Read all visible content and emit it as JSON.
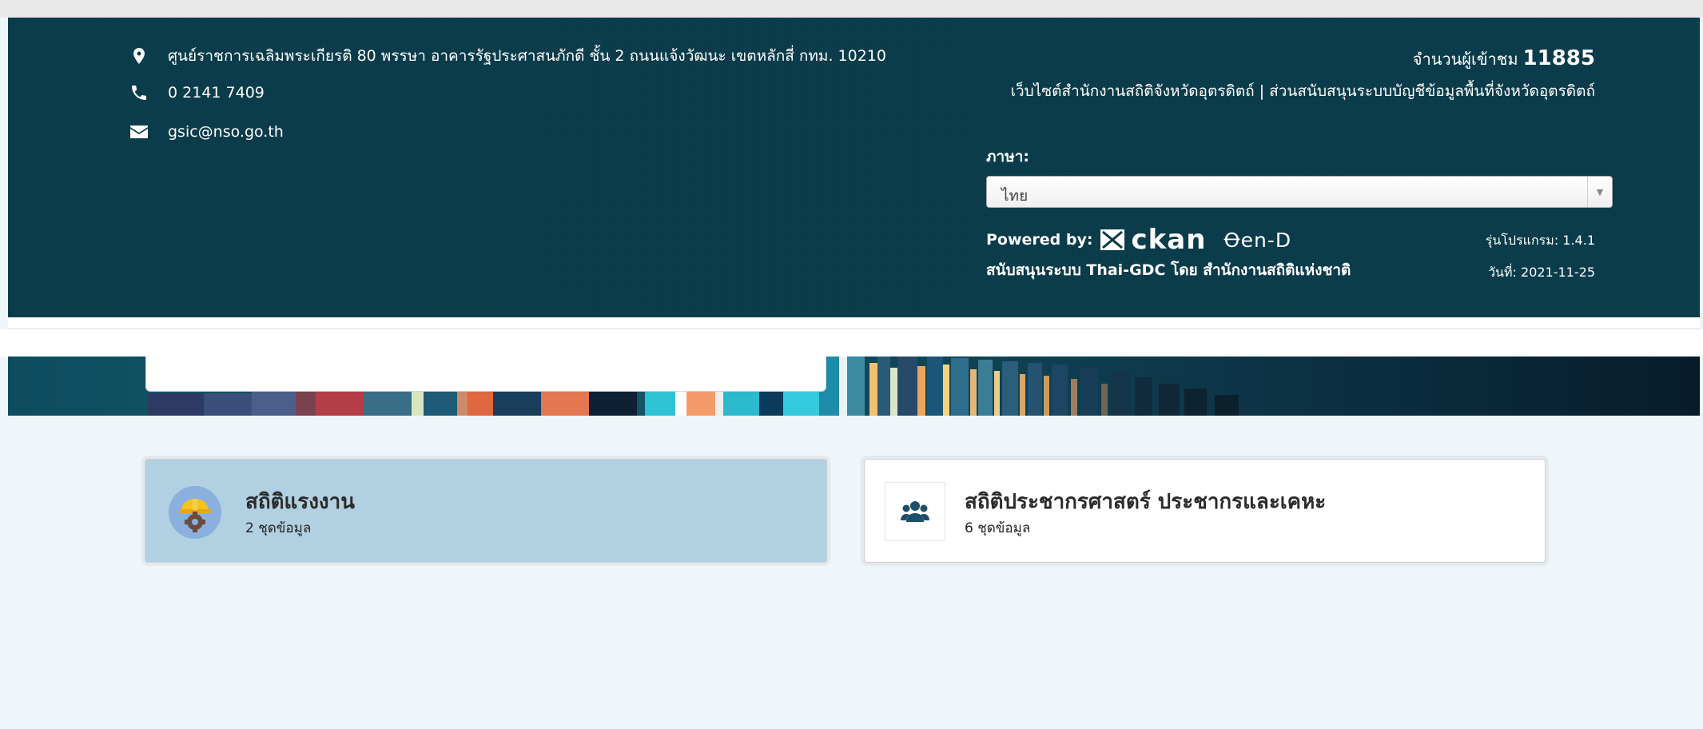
{
  "contact": {
    "address": "ศูนย์ราชการเฉลิมพระเกียรติ 80 พรรษา อาคารรัฐประศาสนภักดี ชั้น 2 ถนนแจ้งวัฒนะ เขตหลักสี่ กทม. 10210",
    "phone": "0 2141 7409",
    "email": "gsic@nso.go.th",
    "icons": [
      "map-marker-icon",
      "phone-icon",
      "envelope-icon"
    ]
  },
  "visitors": {
    "label": "จำนวนผู้เข้าชม",
    "count": "11885"
  },
  "site_description": "เว็บไซต์สำนักงานสถิติจังหวัดอุตรดิตถ์ | ส่วนสนับสนุนระบบบัญชีข้อมูลพื้นที่จังหวัดอุตรดิตถ์",
  "language": {
    "label": "ภาษา:",
    "selected": "ไทย"
  },
  "powered": {
    "label": "Powered by:",
    "ckan": "ckan",
    "opend": "Ꝋen-D",
    "support": "สนับสนุนระบบ Thai-GDC โดย สำนักงานสถิติแห่งชาติ",
    "version": "รุ่นโปรแกรม: 1.4.1",
    "date": "วันที่: 2021-11-25"
  },
  "categories": [
    {
      "title": "สถิติแรงงาน",
      "count": "2 ชุดข้อมูล",
      "icon": "worker-helmet-gear-icon",
      "highlighted": true
    },
    {
      "title": "สถิติประชากรศาสตร์ ประชากรและเคหะ",
      "count": "6 ชุดข้อมูล",
      "icon": "users-group-icon",
      "highlighted": false
    }
  ],
  "colors": {
    "footer_bg": "#0a3b4a",
    "card_highlight": "#b1d0e1",
    "page_bg": "#eef6fa",
    "icon_blue": "#1d4f6a"
  }
}
